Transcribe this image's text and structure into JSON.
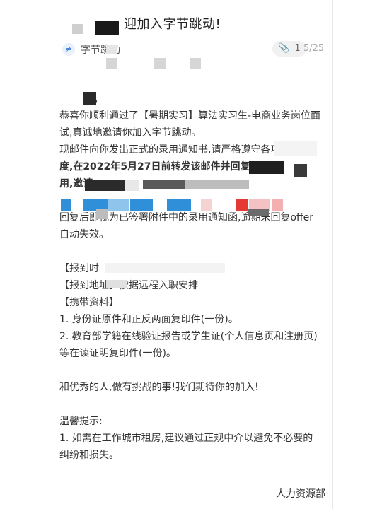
{
  "email": {
    "subject": "迎加入字节跳动!",
    "sender": {
      "avatar_glyph": "≠",
      "name": "字节跳动"
    },
    "attachment_count": "1",
    "page_indicator": "5/25",
    "greeting": "子,",
    "paragraphs": {
      "p1": "恭喜你顺利通过了【暑期实习】算法实习生-电商业务岗位面试,真诚地邀请你加入字节跳动。",
      "p2_line1": "现邮件向你发出正式的录用通知书,请严格遵守各项",
      "p2_line2": "度,在2022年5月27日前转发该邮件并回复",
      "p2_line3": "用,邀请",
      "p2_line4": "回复后即视为已签署附件中的录用通知函,逾期未回复offer自动失效。"
    },
    "report_time_label": "【报到时",
    "report_location": "【报到地址】依据远程入职安排",
    "materials_title": "【携带资料】",
    "materials": [
      "1. 身份证原件和正反两面复印件(一份)。",
      "2. 教育部学籍在线验证报告或学生证(个人信息页和注册页)等在读证明复印件(一份)。"
    ],
    "closing": "和优秀的人,做有挑战的事!我们期待你的加入!",
    "tips_title": "温馨提示:",
    "tips": [
      "1. 如需在工作城市租房,建议通过正规中介以避免不必要的纠纷和损失。"
    ],
    "signature": "人力资源部"
  },
  "colors": {
    "accent_blue": "#2f8fd8",
    "mask_dark": "#2b2b2b",
    "mask_gray": "#cfcfcf"
  }
}
